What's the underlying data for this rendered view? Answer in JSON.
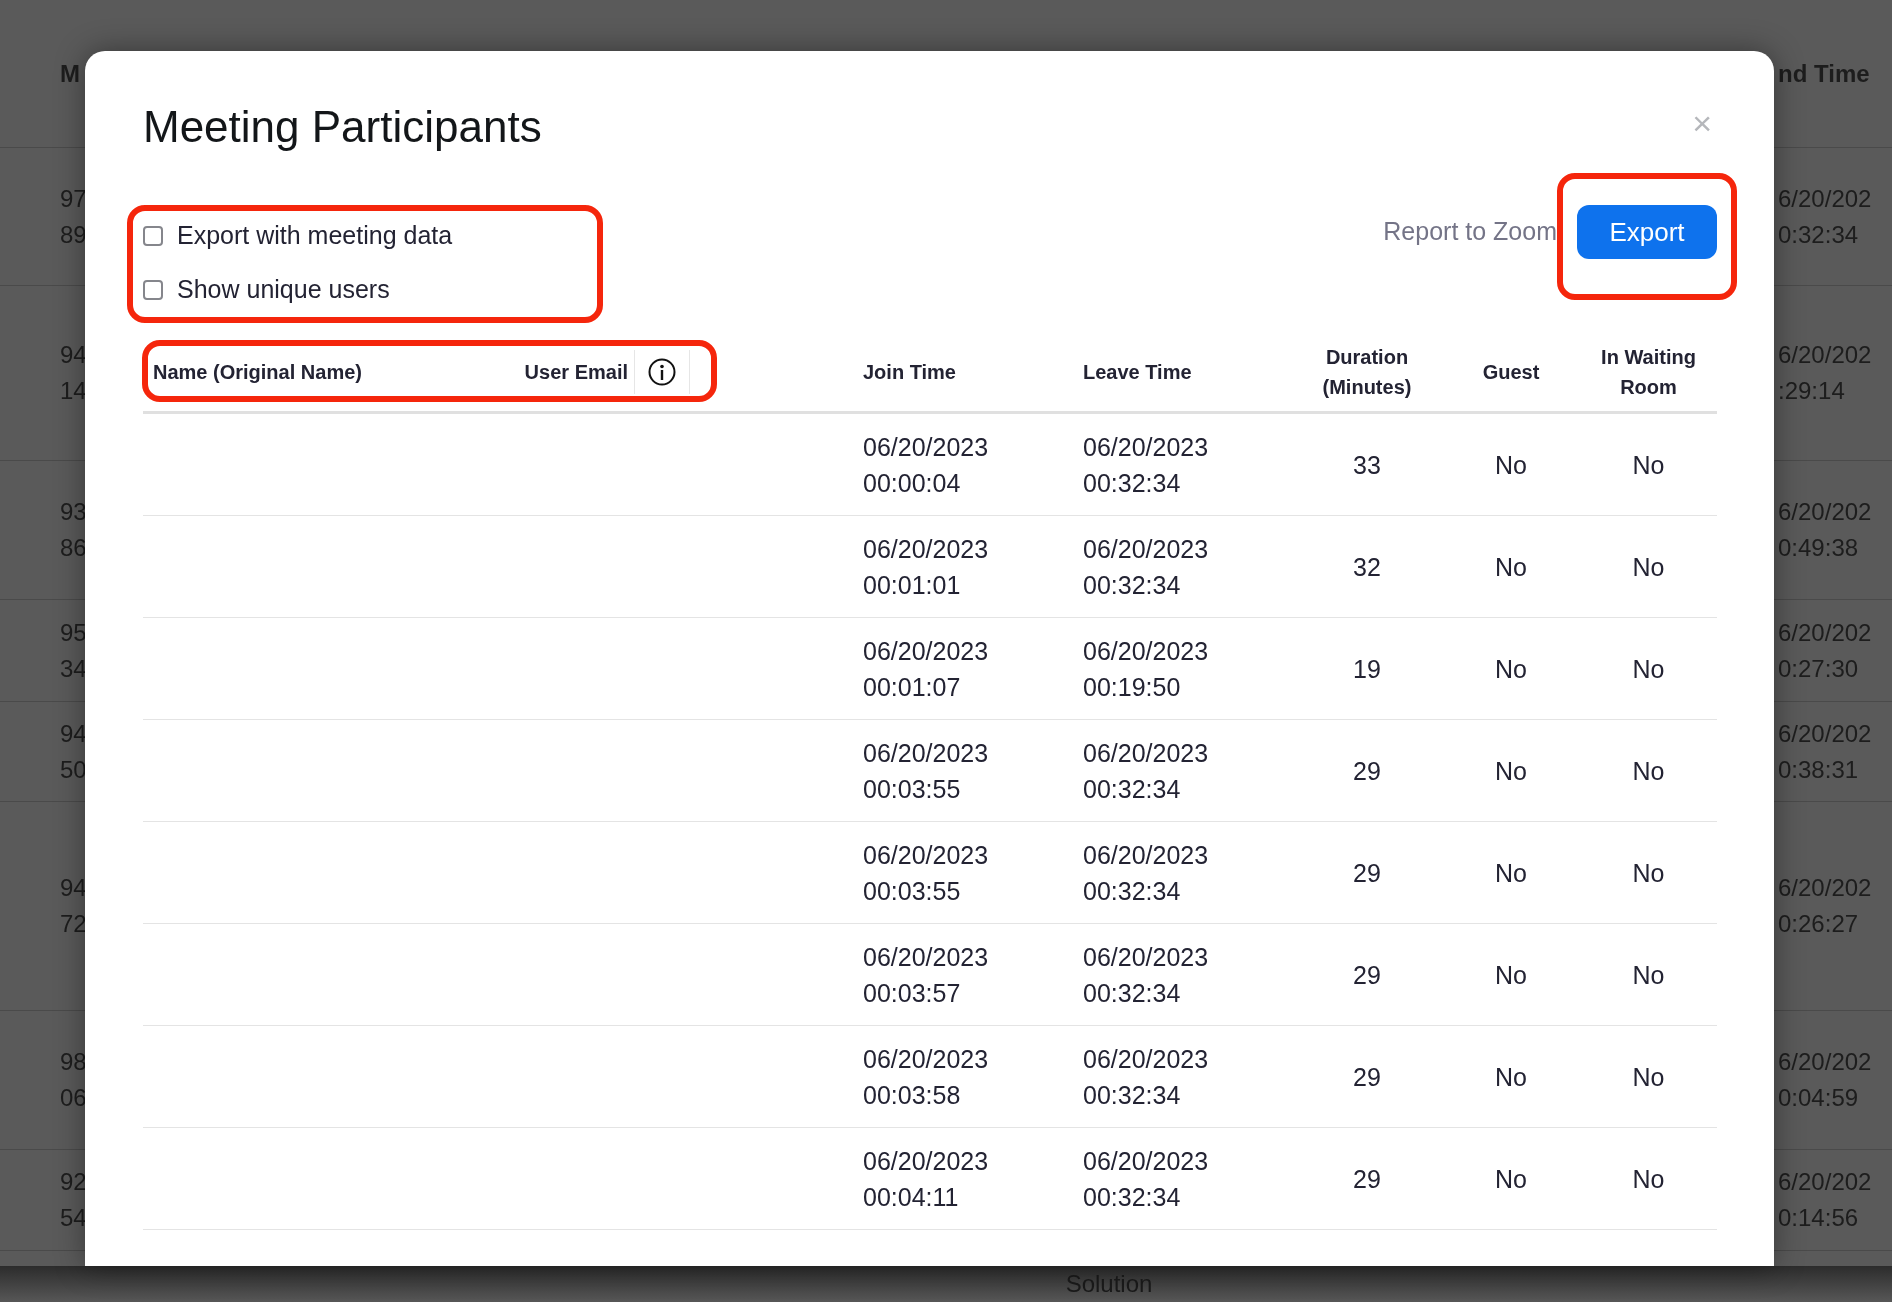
{
  "background": {
    "columns": [
      "M",
      "nd Time"
    ],
    "rows": [
      {
        "column_1": [
          "97",
          "89"
        ],
        "column_2": [
          "6/20/202",
          "0:32:34"
        ]
      },
      {
        "column_1": [
          "94",
          "14"
        ],
        "column_2": [
          "6/20/202",
          ":29:14"
        ]
      },
      {
        "column_1": [
          "93",
          "86"
        ],
        "column_2": [
          "6/20/202",
          "0:49:38"
        ]
      },
      {
        "column_1": [
          "95",
          "34"
        ],
        "column_2": [
          "6/20/202",
          "0:27:30"
        ]
      },
      {
        "column_1": [
          "94",
          "50"
        ],
        "column_2": [
          "6/20/202",
          "0:38:31"
        ]
      },
      {
        "column_1": [
          "94",
          "72"
        ],
        "column_2": [
          "6/20/202",
          "0:26:27"
        ]
      },
      {
        "column_1": [
          "98",
          "06"
        ],
        "column_2": [
          "6/20/202",
          "0:04:59"
        ]
      },
      {
        "column_1": [
          "92",
          "54"
        ],
        "column_2": [
          "6/20/202",
          "0:14:56"
        ]
      }
    ],
    "footer": "Solution"
  },
  "dialog": {
    "title": "Meeting Participants",
    "close": "×",
    "options": [
      {
        "label": "Export with meeting data",
        "checked": false
      },
      {
        "label": "Show unique users",
        "checked": false
      }
    ],
    "report_link": "Report to Zoom",
    "export_button": "Export",
    "table": {
      "columns": [
        "Name (Original Name)",
        "User Email",
        "Join Time",
        "Leave Time",
        "Duration (Minutes)",
        "Guest",
        "In Waiting Room"
      ],
      "rows": [
        {
          "join_time": [
            "06/20/2023",
            "00:00:04"
          ],
          "leave_time": [
            "06/20/2023",
            "00:32:34"
          ],
          "duration": "33",
          "guest": "No",
          "in_waiting_room": "No"
        },
        {
          "join_time": [
            "06/20/2023",
            "00:01:01"
          ],
          "leave_time": [
            "06/20/2023",
            "00:32:34"
          ],
          "duration": "32",
          "guest": "No",
          "in_waiting_room": "No"
        },
        {
          "join_time": [
            "06/20/2023",
            "00:01:07"
          ],
          "leave_time": [
            "06/20/2023",
            "00:19:50"
          ],
          "duration": "19",
          "guest": "No",
          "in_waiting_room": "No"
        },
        {
          "join_time": [
            "06/20/2023",
            "00:03:55"
          ],
          "leave_time": [
            "06/20/2023",
            "00:32:34"
          ],
          "duration": "29",
          "guest": "No",
          "in_waiting_room": "No"
        },
        {
          "join_time": [
            "06/20/2023",
            "00:03:55"
          ],
          "leave_time": [
            "06/20/2023",
            "00:32:34"
          ],
          "duration": "29",
          "guest": "No",
          "in_waiting_room": "No"
        },
        {
          "join_time": [
            "06/20/2023",
            "00:03:57"
          ],
          "leave_time": [
            "06/20/2023",
            "00:32:34"
          ],
          "duration": "29",
          "guest": "No",
          "in_waiting_room": "No"
        },
        {
          "join_time": [
            "06/20/2023",
            "00:03:58"
          ],
          "leave_time": [
            "06/20/2023",
            "00:32:34"
          ],
          "duration": "29",
          "guest": "No",
          "in_waiting_room": "No"
        },
        {
          "join_time": [
            "06/20/2023",
            "00:04:11"
          ],
          "leave_time": [
            "06/20/2023",
            "00:32:34"
          ],
          "duration": "29",
          "guest": "No",
          "in_waiting_room": "No"
        }
      ]
    }
  }
}
